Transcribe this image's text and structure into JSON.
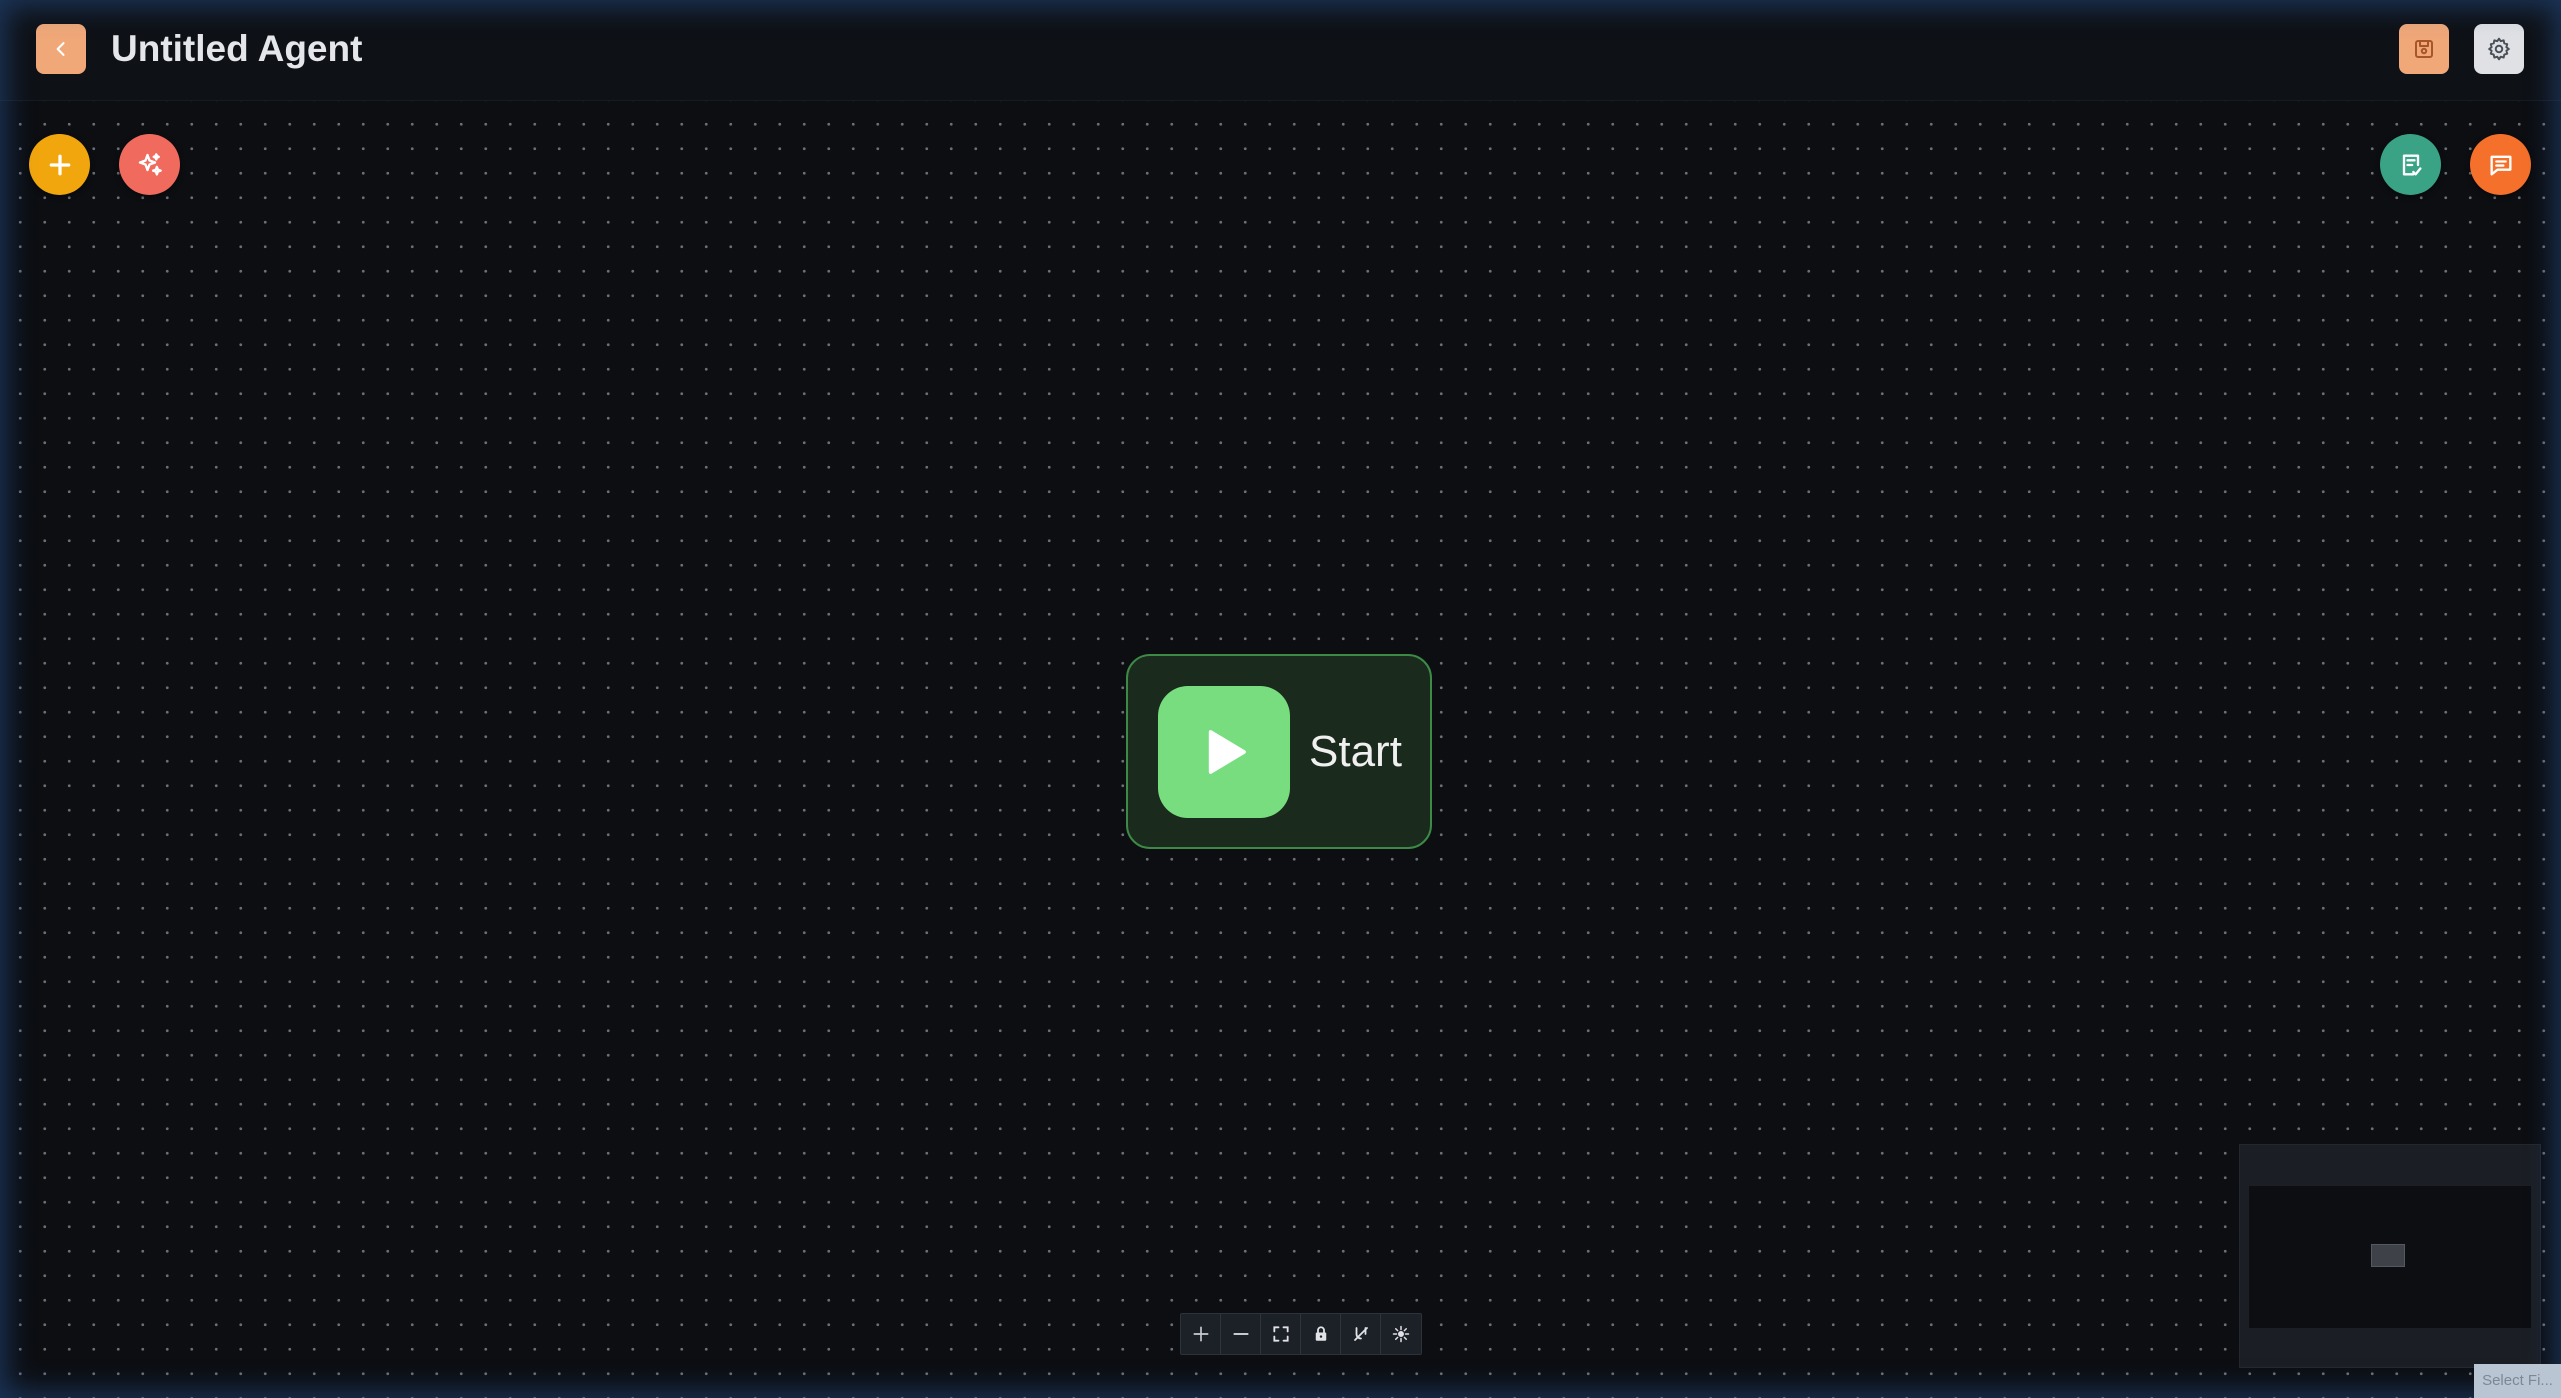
{
  "header": {
    "title": "Untitled Agent"
  },
  "canvas": {
    "start_node": {
      "label": "Start"
    }
  },
  "corner_tag": {
    "text": "Select Fi..."
  },
  "icons": {
    "back": "chevron-left-icon",
    "save": "save-icon",
    "settings": "gear-icon",
    "add": "plus-icon",
    "ai": "sparkles-icon",
    "notes": "checklist-icon",
    "chat": "chat-icon",
    "start": "play-icon",
    "zoom_in": "plus-icon",
    "zoom_out": "minus-icon",
    "fit": "fit-view-icon",
    "lock": "lock-icon",
    "layout": "snap-icon",
    "center": "center-focus-icon"
  },
  "colors": {
    "accent_orange": "#f0a878",
    "add_button": "#f2a60d",
    "ai_button": "#f06a5e",
    "notes_button": "#3aa386",
    "chat_button": "#f5702a",
    "start_green": "#77dd7f"
  }
}
